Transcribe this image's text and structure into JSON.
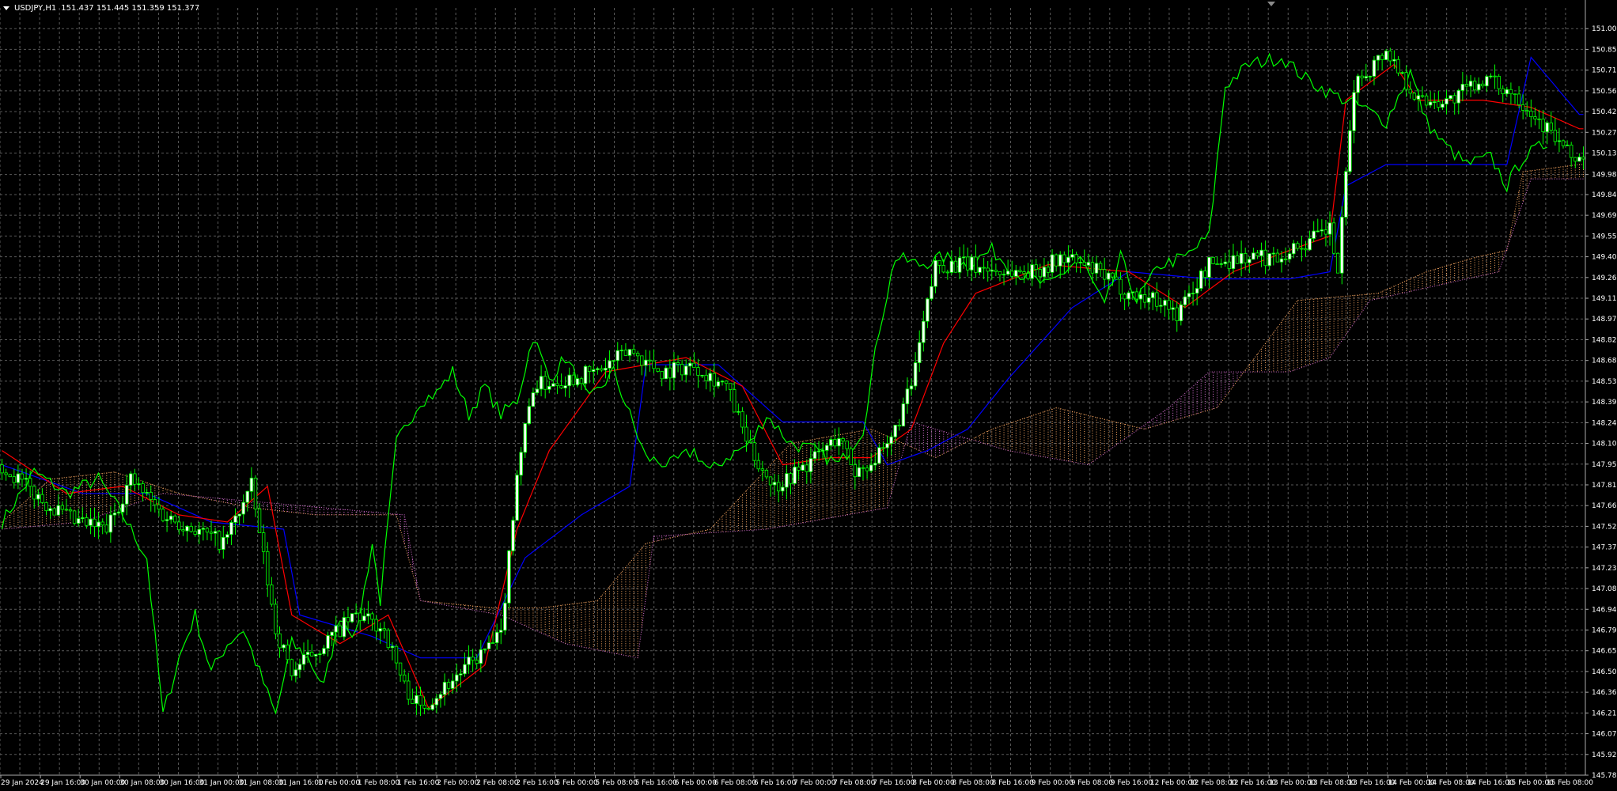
{
  "header": {
    "symbol_timeframe": "USDJPY,H1",
    "ohlc": "151.437 151.445 151.359 151.377"
  },
  "colors": {
    "background": "#000000",
    "grid": "#5a5a5a",
    "axis_text": "#ffffff",
    "candle_bull": "#ffffff",
    "candle_bear": "#00ff00",
    "tenkan": "#ff0000",
    "kijun": "#0000ff",
    "chikou": "#00ff00",
    "kumo_bull": "#f4a460",
    "kumo_bear": "#da70d6"
  },
  "chart_data": {
    "type": "candlestick",
    "indicator": "Ichimoku Kinko Hyo",
    "ylim": [
      145.78,
      151.145
    ],
    "y_ticks": [
      "151.000",
      "150.855",
      "150.710",
      "150.565",
      "150.420",
      "150.275",
      "150.130",
      "149.980",
      "149.840",
      "149.695",
      "149.550",
      "149.405",
      "149.260",
      "149.115",
      "148.970",
      "148.825",
      "148.680",
      "148.535",
      "148.390",
      "148.245",
      "148.100",
      "147.955",
      "147.810",
      "147.665",
      "147.520",
      "147.375",
      "147.230",
      "147.085",
      "146.940",
      "146.795",
      "146.650",
      "146.505",
      "146.360",
      "146.215",
      "146.070",
      "145.925",
      "145.780"
    ],
    "x_ticks": [
      "29 Jan 2024",
      "29 Jan 16:00",
      "30 Jan 00:00",
      "30 Jan 08:00",
      "30 Jan 16:00",
      "31 Jan 00:00",
      "31 Jan 08:00",
      "31 Jan 16:00",
      "1 Feb 00:00",
      "1 Feb 08:00",
      "1 Feb 16:00",
      "2 Feb 00:00",
      "2 Feb 08:00",
      "2 Feb 16:00",
      "5 Feb 00:00",
      "5 Feb 08:00",
      "5 Feb 16:00",
      "6 Feb 00:00",
      "6 Feb 08:00",
      "6 Feb 16:00",
      "7 Feb 00:00",
      "7 Feb 08:00",
      "7 Feb 16:00",
      "8 Feb 00:00",
      "8 Feb 08:00",
      "8 Feb 16:00",
      "9 Feb 00:00",
      "9 Feb 08:00",
      "9 Feb 16:00",
      "12 Feb 00:00",
      "12 Feb 08:00",
      "12 Feb 16:00",
      "13 Feb 00:00",
      "13 Feb 08:00",
      "13 Feb 16:00",
      "14 Feb 00:00",
      "14 Feb 08:00",
      "14 Feb 16:00",
      "15 Feb 00:00",
      "15 Feb 08:00"
    ],
    "close_anchors": [
      [
        0,
        147.95
      ],
      [
        10,
        147.7
      ],
      [
        18,
        147.55
      ],
      [
        26,
        147.5
      ],
      [
        32,
        147.85
      ],
      [
        40,
        147.6
      ],
      [
        48,
        147.5
      ],
      [
        55,
        147.4
      ],
      [
        62,
        147.8
      ],
      [
        68,
        146.8
      ],
      [
        72,
        146.5
      ],
      [
        80,
        146.7
      ],
      [
        88,
        146.9
      ],
      [
        95,
        146.8
      ],
      [
        100,
        146.4
      ],
      [
        104,
        146.25
      ],
      [
        112,
        146.45
      ],
      [
        118,
        146.6
      ],
      [
        124,
        146.75
      ],
      [
        128,
        147.9
      ],
      [
        132,
        148.5
      ],
      [
        140,
        148.55
      ],
      [
        148,
        148.6
      ],
      [
        156,
        148.75
      ],
      [
        164,
        148.6
      ],
      [
        172,
        148.65
      ],
      [
        180,
        148.5
      ],
      [
        186,
        148.05
      ],
      [
        192,
        147.8
      ],
      [
        200,
        147.95
      ],
      [
        208,
        148.15
      ],
      [
        212,
        147.9
      ],
      [
        220,
        148.05
      ],
      [
        226,
        148.5
      ],
      [
        232,
        149.35
      ],
      [
        240,
        149.35
      ],
      [
        248,
        149.3
      ],
      [
        256,
        149.3
      ],
      [
        264,
        149.4
      ],
      [
        272,
        149.3
      ],
      [
        280,
        149.15
      ],
      [
        288,
        149.1
      ],
      [
        292,
        149.0
      ],
      [
        300,
        149.35
      ],
      [
        308,
        149.4
      ],
      [
        316,
        149.4
      ],
      [
        324,
        149.5
      ],
      [
        330,
        149.6
      ],
      [
        332,
        149.3
      ],
      [
        336,
        150.6
      ],
      [
        344,
        150.85
      ],
      [
        352,
        150.5
      ],
      [
        360,
        150.5
      ],
      [
        368,
        150.65
      ],
      [
        376,
        150.55
      ],
      [
        384,
        150.3
      ],
      [
        390,
        150.1
      ]
    ],
    "tenkan_anchors": [
      [
        0,
        148.05
      ],
      [
        16,
        147.75
      ],
      [
        30,
        147.8
      ],
      [
        44,
        147.6
      ],
      [
        56,
        147.55
      ],
      [
        66,
        147.8
      ],
      [
        72,
        146.9
      ],
      [
        84,
        146.7
      ],
      [
        96,
        146.9
      ],
      [
        106,
        146.25
      ],
      [
        120,
        146.55
      ],
      [
        128,
        147.5
      ],
      [
        136,
        148.05
      ],
      [
        150,
        148.6
      ],
      [
        170,
        148.7
      ],
      [
        184,
        148.5
      ],
      [
        194,
        147.95
      ],
      [
        206,
        148.0
      ],
      [
        216,
        148.0
      ],
      [
        226,
        148.2
      ],
      [
        234,
        148.8
      ],
      [
        242,
        149.15
      ],
      [
        260,
        149.35
      ],
      [
        280,
        149.3
      ],
      [
        294,
        149.05
      ],
      [
        306,
        149.3
      ],
      [
        320,
        149.45
      ],
      [
        330,
        149.55
      ],
      [
        334,
        150.5
      ],
      [
        346,
        150.75
      ],
      [
        352,
        150.5
      ],
      [
        368,
        150.5
      ],
      [
        380,
        150.45
      ],
      [
        392,
        150.3
      ]
    ],
    "kijun_anchors": [
      [
        0,
        147.95
      ],
      [
        20,
        147.75
      ],
      [
        36,
        147.75
      ],
      [
        52,
        147.55
      ],
      [
        70,
        147.5
      ],
      [
        74,
        146.9
      ],
      [
        92,
        146.75
      ],
      [
        104,
        146.6
      ],
      [
        118,
        146.6
      ],
      [
        130,
        147.3
      ],
      [
        144,
        147.6
      ],
      [
        156,
        147.8
      ],
      [
        160,
        148.65
      ],
      [
        178,
        148.65
      ],
      [
        194,
        148.25
      ],
      [
        214,
        148.25
      ],
      [
        220,
        147.95
      ],
      [
        230,
        148.05
      ],
      [
        240,
        148.2
      ],
      [
        250,
        148.55
      ],
      [
        266,
        149.05
      ],
      [
        280,
        149.3
      ],
      [
        300,
        149.25
      ],
      [
        320,
        149.25
      ],
      [
        330,
        149.3
      ],
      [
        334,
        149.9
      ],
      [
        344,
        150.05
      ],
      [
        364,
        150.05
      ],
      [
        374,
        150.05
      ],
      [
        380,
        150.8
      ],
      [
        392,
        150.4
      ]
    ],
    "senkou_a_anchors": [
      [
        0,
        147.55
      ],
      [
        12,
        147.85
      ],
      [
        28,
        147.9
      ],
      [
        44,
        147.75
      ],
      [
        62,
        147.65
      ],
      [
        78,
        147.6
      ],
      [
        98,
        147.6
      ],
      [
        104,
        147.0
      ],
      [
        122,
        146.95
      ],
      [
        134,
        146.95
      ],
      [
        148,
        147.0
      ],
      [
        160,
        147.4
      ],
      [
        176,
        147.5
      ],
      [
        196,
        148.1
      ],
      [
        216,
        148.2
      ],
      [
        232,
        148.0
      ],
      [
        246,
        148.2
      ],
      [
        262,
        148.35
      ],
      [
        284,
        148.2
      ],
      [
        302,
        148.35
      ],
      [
        322,
        149.1
      ],
      [
        342,
        149.15
      ],
      [
        354,
        149.3
      ],
      [
        366,
        149.4
      ],
      [
        374,
        149.45
      ],
      [
        378,
        150.0
      ],
      [
        392,
        150.05
      ]
    ],
    "senkou_b_anchors": [
      [
        0,
        147.5
      ],
      [
        20,
        147.55
      ],
      [
        40,
        147.75
      ],
      [
        60,
        147.7
      ],
      [
        80,
        147.65
      ],
      [
        100,
        147.6
      ],
      [
        104,
        147.0
      ],
      [
        124,
        146.9
      ],
      [
        140,
        146.7
      ],
      [
        158,
        146.6
      ],
      [
        162,
        147.45
      ],
      [
        190,
        147.5
      ],
      [
        220,
        147.65
      ],
      [
        226,
        148.25
      ],
      [
        250,
        148.05
      ],
      [
        270,
        147.95
      ],
      [
        290,
        148.35
      ],
      [
        300,
        148.6
      ],
      [
        320,
        148.6
      ],
      [
        330,
        148.7
      ],
      [
        340,
        149.1
      ],
      [
        356,
        149.2
      ],
      [
        372,
        149.3
      ],
      [
        380,
        149.95
      ],
      [
        392,
        149.95
      ]
    ],
    "chikou_anchors": [
      [
        0,
        147.55
      ],
      [
        8,
        147.9
      ],
      [
        16,
        147.75
      ],
      [
        24,
        147.85
      ],
      [
        30,
        147.6
      ],
      [
        36,
        147.3
      ],
      [
        40,
        146.2
      ],
      [
        44,
        146.6
      ],
      [
        48,
        146.9
      ],
      [
        52,
        146.5
      ],
      [
        56,
        146.7
      ],
      [
        60,
        146.8
      ],
      [
        64,
        146.5
      ],
      [
        68,
        146.2
      ],
      [
        72,
        146.7
      ],
      [
        76,
        146.6
      ],
      [
        80,
        146.4
      ],
      [
        84,
        146.9
      ],
      [
        88,
        146.75
      ],
      [
        92,
        147.4
      ],
      [
        94,
        147.0
      ],
      [
        98,
        148.1
      ],
      [
        104,
        148.4
      ],
      [
        108,
        148.45
      ],
      [
        112,
        148.6
      ],
      [
        116,
        148.3
      ],
      [
        120,
        148.5
      ],
      [
        124,
        148.3
      ],
      [
        128,
        148.4
      ],
      [
        132,
        148.85
      ],
      [
        136,
        148.55
      ],
      [
        140,
        148.7
      ],
      [
        146,
        148.4
      ],
      [
        152,
        148.6
      ],
      [
        156,
        148.3
      ],
      [
        160,
        148.0
      ],
      [
        166,
        147.95
      ],
      [
        172,
        148.05
      ],
      [
        176,
        147.9
      ],
      [
        180,
        148.0
      ],
      [
        186,
        148.1
      ],
      [
        190,
        148.3
      ],
      [
        196,
        148.1
      ],
      [
        202,
        148.05
      ],
      [
        208,
        147.95
      ],
      [
        214,
        148.2
      ],
      [
        218,
        148.9
      ],
      [
        222,
        149.4
      ],
      [
        228,
        149.35
      ],
      [
        234,
        149.4
      ],
      [
        240,
        149.35
      ],
      [
        246,
        149.45
      ],
      [
        252,
        149.3
      ],
      [
        260,
        149.2
      ],
      [
        268,
        149.4
      ],
      [
        274,
        149.05
      ],
      [
        278,
        149.4
      ],
      [
        282,
        149.1
      ],
      [
        288,
        149.35
      ],
      [
        294,
        149.4
      ],
      [
        300,
        149.55
      ],
      [
        304,
        150.6
      ],
      [
        310,
        150.75
      ],
      [
        318,
        150.8
      ],
      [
        324,
        150.65
      ],
      [
        330,
        150.55
      ],
      [
        338,
        150.45
      ],
      [
        344,
        150.35
      ],
      [
        350,
        150.7
      ],
      [
        354,
        150.35
      ],
      [
        358,
        150.2
      ],
      [
        364,
        150.05
      ],
      [
        370,
        150.1
      ],
      [
        374,
        149.9
      ],
      [
        378,
        150.1
      ],
      [
        384,
        150.2
      ]
    ]
  }
}
